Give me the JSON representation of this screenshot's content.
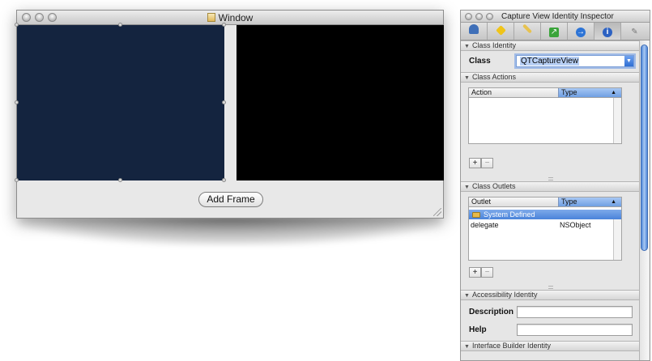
{
  "window": {
    "title": "Window",
    "add_frame_label": "Add Frame"
  },
  "inspector": {
    "title": "Capture View Identity Inspector",
    "tabs": [
      {
        "icon": "attributes-icon"
      },
      {
        "icon": "effects-icon"
      },
      {
        "icon": "size-ruler-icon"
      },
      {
        "icon": "connections-icon"
      },
      {
        "icon": "bindings-icon"
      },
      {
        "icon": "identity-info-icon"
      },
      {
        "icon": "applescript-icon"
      }
    ],
    "class_identity": {
      "header": "Class Identity",
      "class_label": "Class",
      "class_value": "QTCaptureView"
    },
    "class_actions": {
      "header": "Class Actions",
      "col_action": "Action",
      "col_type": "Type"
    },
    "class_outlets": {
      "header": "Class Outlets",
      "col_outlet": "Outlet",
      "col_type": "Type",
      "group_label": "System Defined",
      "rows": [
        {
          "outlet": "delegate",
          "type": "NSObject"
        }
      ]
    },
    "add_symbol": "+",
    "remove_symbol": "−",
    "accessibility": {
      "header": "Accessibility Identity",
      "description_label": "Description",
      "help_label": "Help"
    },
    "ib_identity": {
      "header": "Interface Builder Identity"
    }
  },
  "colors": {
    "capture_view_left": "#14243f",
    "capture_view_right": "#000000",
    "selection_blue": "#4a83da"
  }
}
